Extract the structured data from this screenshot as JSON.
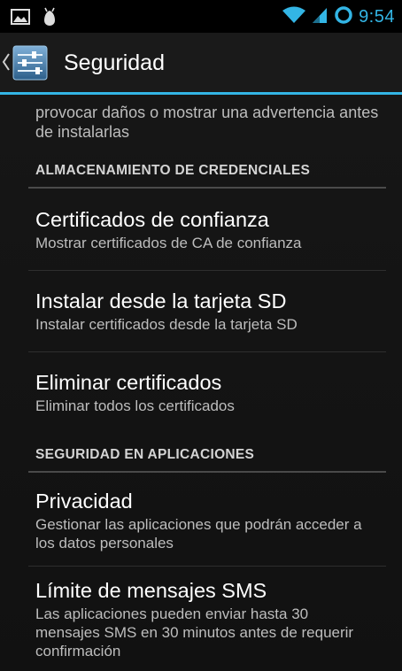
{
  "status_bar": {
    "time": "9:54",
    "icons": [
      "picture-icon",
      "usb-debug-icon",
      "wifi-icon",
      "signal-icon",
      "sync-icon"
    ],
    "accent_color": "#33b5e5"
  },
  "action_bar": {
    "title": "Seguridad",
    "icon": "settings-sliders-icon",
    "up_icon": "chevron-left-icon"
  },
  "top_summary": "provocar daños o mostrar una advertencia antes de instalarlas",
  "sections": [
    {
      "header": "ALMACENAMIENTO DE CREDENCIALES",
      "items": [
        {
          "title": "Certificados de confianza",
          "summary": "Mostrar certificados de CA de confianza"
        },
        {
          "title": "Instalar desde la tarjeta SD",
          "summary": "Instalar certificados desde la tarjeta SD"
        },
        {
          "title": "Eliminar certificados",
          "summary": "Eliminar todos los certificados"
        }
      ]
    },
    {
      "header": "SEGURIDAD EN APLICACIONES",
      "items": [
        {
          "title": "Privacidad",
          "summary": "Gestionar las aplicaciones que podrán acceder a los datos personales"
        },
        {
          "title": "Límite de mensajes SMS",
          "summary": "Las aplicaciones pueden enviar hasta 30 mensajes SMS en 30 minutos antes de requerir confirmación"
        }
      ]
    }
  ]
}
